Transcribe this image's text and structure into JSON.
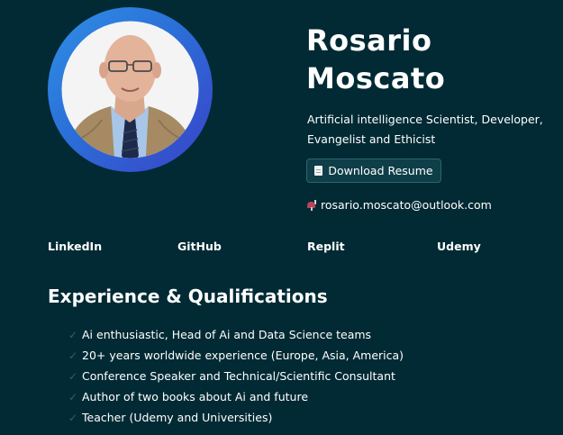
{
  "profile": {
    "name_line1": "Rosario",
    "name_line2": "Moscato",
    "tagline": "Artificial intelligence Scientist, Developer, Evangelist and Ethicist",
    "avatar_alt": "Rosario Moscato"
  },
  "actions": {
    "resume_icon": "document-icon",
    "resume_label": "Download Resume",
    "email_icon": "mailbox-icon",
    "email": "rosario.moscato@outlook.com"
  },
  "links": [
    {
      "label": "LinkedIn"
    },
    {
      "label": "GitHub"
    },
    {
      "label": "Replit"
    },
    {
      "label": "Udemy"
    }
  ],
  "experience": {
    "title": "Experience & Qualifications",
    "items": [
      "Ai enthusiastic, Head of Ai and Data Science teams",
      "20+ years worldwide experience (Europe, Asia, America)",
      "Conference Speaker and Technical/Scientific Consultant",
      "Author of two books about Ai and future",
      "Teacher (Udemy and Universities)"
    ]
  },
  "colors": {
    "background": "#012a34",
    "text": "#ffffff",
    "avatar_ring_start": "#2f8fe6",
    "avatar_ring_end": "#3a42c8",
    "check_mark": "#3f5a62"
  }
}
